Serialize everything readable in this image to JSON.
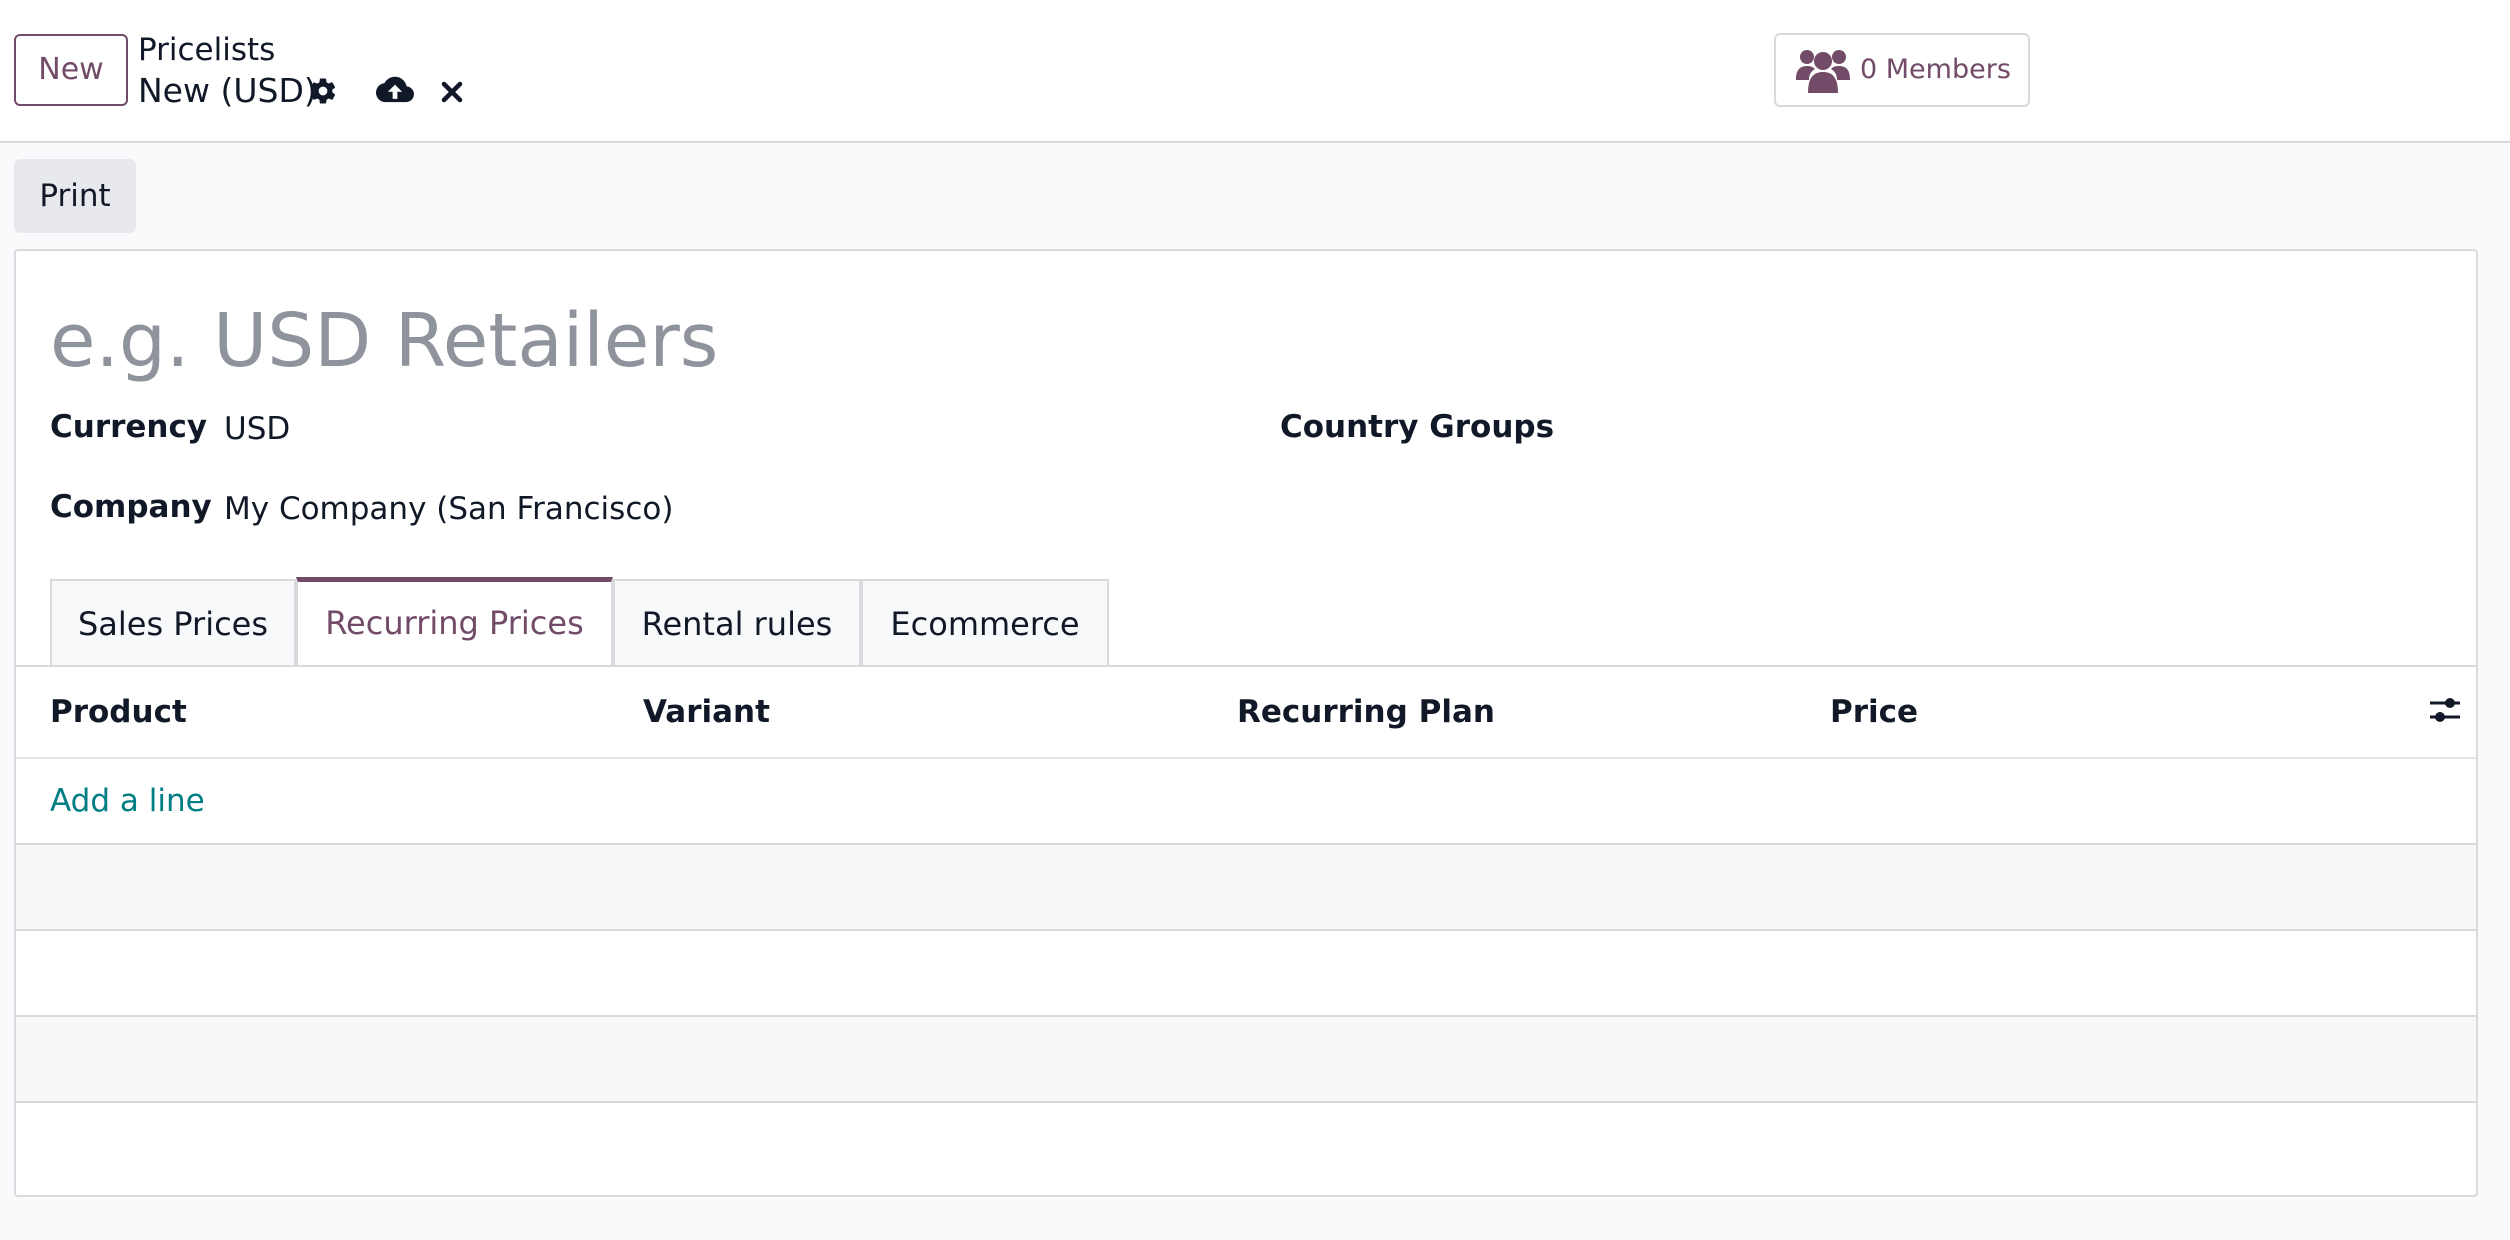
{
  "control_panel": {
    "new_button": "New",
    "breadcrumb": "Pricelists",
    "record_name": "New (USD)",
    "icons": [
      "gear-icon",
      "cloud-upload-icon",
      "close-icon"
    ],
    "members_icon": "users-icon",
    "members_label": "0 Members"
  },
  "statusbar": {
    "print_label": "Print"
  },
  "form": {
    "name_placeholder": "e.g. USD Retailers",
    "name_value": "",
    "currency_label": "Currency",
    "currency_value": "USD",
    "company_label": "Company",
    "company_value": "My Company (San Francisco)",
    "country_groups_label": "Country Groups",
    "country_groups_value": ""
  },
  "tabs": [
    {
      "label": "Sales Prices",
      "active": false
    },
    {
      "label": "Recurring Prices",
      "active": true
    },
    {
      "label": "Rental rules",
      "active": false
    },
    {
      "label": "Ecommerce",
      "active": false
    }
  ],
  "list": {
    "columns": [
      "Product",
      "Variant",
      "Recurring Plan",
      "Price"
    ],
    "optional_columns_icon": "sliders-icon",
    "add_line_label": "Add a line",
    "rows": []
  },
  "colors": {
    "brand": "#714b67",
    "link": "#017e84",
    "border": "#d8dadd",
    "background": "#f9fafb"
  }
}
